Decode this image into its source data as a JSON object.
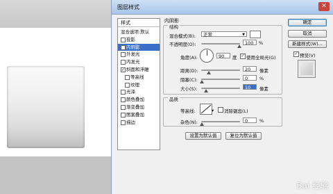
{
  "window": {
    "title": "图层样式"
  },
  "sidebar": {
    "header": "样式",
    "items": [
      {
        "label": "混合选项:默认",
        "checkbox": false,
        "checked": false,
        "sub": false,
        "active": false
      },
      {
        "label": "投影",
        "checkbox": true,
        "checked": false,
        "sub": false,
        "active": false
      },
      {
        "label": "内阴影",
        "checkbox": true,
        "checked": true,
        "sub": false,
        "active": true
      },
      {
        "label": "外发光",
        "checkbox": true,
        "checked": false,
        "sub": false,
        "active": false
      },
      {
        "label": "内发光",
        "checkbox": true,
        "checked": false,
        "sub": false,
        "active": false
      },
      {
        "label": "斜面和浮雕",
        "checkbox": true,
        "checked": true,
        "sub": false,
        "active": false
      },
      {
        "label": "等高线",
        "checkbox": true,
        "checked": false,
        "sub": true,
        "active": false
      },
      {
        "label": "纹理",
        "checkbox": true,
        "checked": false,
        "sub": true,
        "active": false
      },
      {
        "label": "光泽",
        "checkbox": true,
        "checked": false,
        "sub": false,
        "active": false
      },
      {
        "label": "颜色叠加",
        "checkbox": true,
        "checked": false,
        "sub": false,
        "active": false
      },
      {
        "label": "渐变叠加",
        "checkbox": true,
        "checked": false,
        "sub": false,
        "active": false
      },
      {
        "label": "图案叠加",
        "checkbox": true,
        "checked": false,
        "sub": false,
        "active": false
      },
      {
        "label": "描边",
        "checkbox": true,
        "checked": false,
        "sub": false,
        "active": false
      }
    ]
  },
  "panel": {
    "title": "内阴影",
    "structure": {
      "title": "结构",
      "blend_mode_label": "混合模式(B):",
      "blend_mode_value": "正常",
      "opacity_label": "不透明度(O):",
      "opacity_value": "100",
      "angle_label": "角度(A):",
      "angle_value": "90",
      "angle_unit": "度",
      "global_light_label": "使用全局光(G)",
      "distance_label": "距离(D):",
      "distance_value": "20",
      "choke_label": "阻塞(C):",
      "choke_value": "0",
      "size_label": "大小(S):",
      "size_value": "10",
      "unit_px": "像素",
      "unit_pct": "%"
    },
    "quality": {
      "title": "品质",
      "contour_label": "等高线:",
      "antialias_label": "消除锯齿(L)",
      "noise_label": "杂色(N):",
      "noise_value": "0"
    },
    "buttons": {
      "set_default": "设置为默认值",
      "reset_default": "复位为默认值"
    }
  },
  "actions": {
    "ok": "确定",
    "cancel": "取消",
    "new_style": "新建样式(W)...",
    "preview_label": "预览(V)"
  },
  "watermark": "Bai 经验",
  "colors": {
    "selection": "#3a70c8",
    "title_bar": "#a9c5e8"
  }
}
